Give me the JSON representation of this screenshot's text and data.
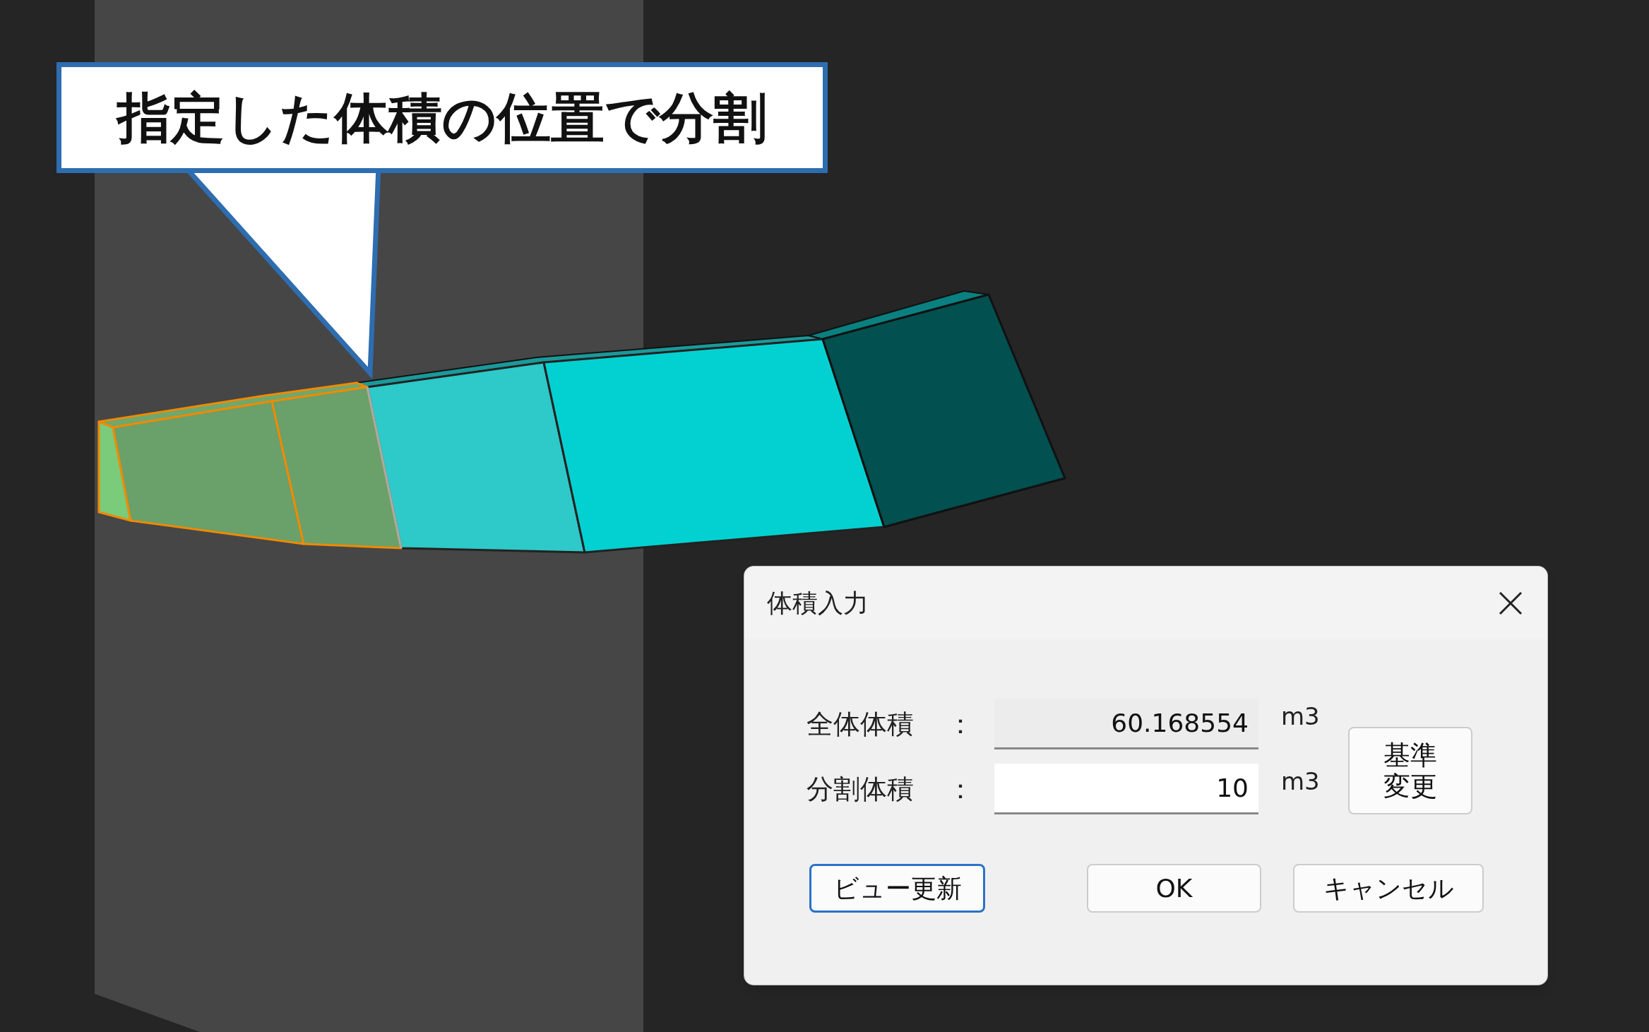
{
  "callout": {
    "text": "指定した体積の位置で分割"
  },
  "dialog": {
    "title": "体積入力",
    "fields": [
      {
        "label": "全体体積",
        "separator": "：",
        "value": "60.168554",
        "unit": "m3",
        "readonly": true
      },
      {
        "label": "分割体積",
        "separator": "：",
        "value": "10",
        "unit": "m3",
        "readonly": false
      }
    ],
    "side_button": "基準変更",
    "buttons": [
      {
        "label": "ビュー更新",
        "focused": true
      },
      {
        "label": "OK",
        "focused": false
      },
      {
        "label": "キャンセル",
        "focused": false
      }
    ]
  }
}
